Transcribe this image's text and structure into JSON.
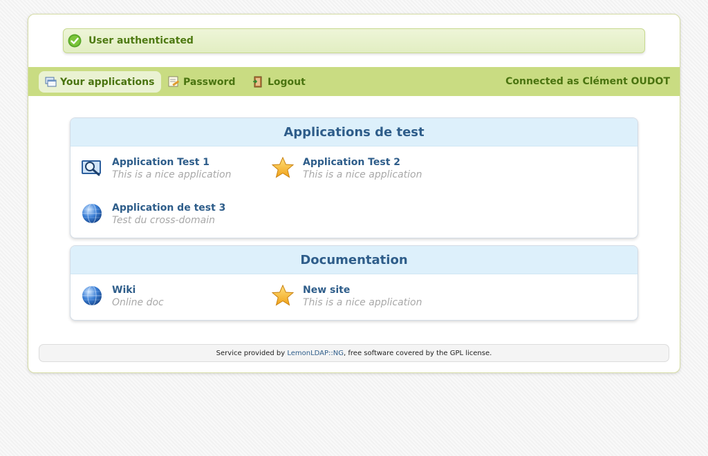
{
  "alert": {
    "message": "User authenticated",
    "icon": "check-circle-icon",
    "color": "#4e7a12"
  },
  "menu": {
    "items": [
      {
        "label": "Your applications",
        "icon": "applications-icon",
        "active": true
      },
      {
        "label": "Password",
        "icon": "password-icon",
        "active": false
      },
      {
        "label": "Logout",
        "icon": "logout-icon",
        "active": false
      }
    ],
    "connected": "Connected as Clément OUDOT"
  },
  "categories": [
    {
      "title": "Applications de test",
      "apps": [
        {
          "name": "Application Test 1",
          "description": "This is a nice application",
          "icon": "magnifier-icon"
        },
        {
          "name": "Application Test 2",
          "description": "This is a nice application",
          "icon": "star-icon"
        },
        {
          "name": "Application de test 3",
          "description": "Test du cross-domain",
          "icon": "globe-icon"
        }
      ]
    },
    {
      "title": "Documentation",
      "apps": [
        {
          "name": "Wiki",
          "description": "Online doc",
          "icon": "globe-icon"
        },
        {
          "name": "New site",
          "description": "This is a nice application",
          "icon": "star-icon"
        }
      ]
    }
  ],
  "footer": {
    "prefix": "Service provided by ",
    "link": "LemonLDAP::NG",
    "suffix": ", free software covered by the GPL license."
  },
  "colors": {
    "menubar": "#c9dc82",
    "category_header": "#ddf0fb",
    "link": "#2e5d8a"
  }
}
